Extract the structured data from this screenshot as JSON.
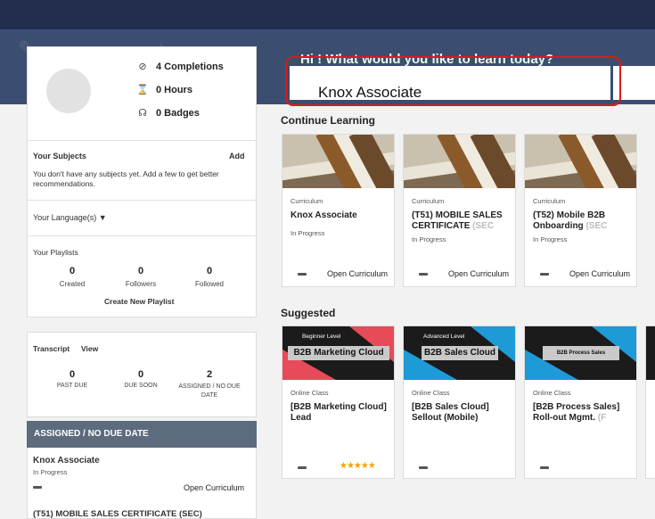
{
  "hero": {
    "title": "Hi ! What would you like to learn today?",
    "search_value": "Knox Associate"
  },
  "profile": {
    "completions": "4 Completions",
    "hours": "0 Hours",
    "badges": "0 Badges",
    "subjects_title": "Your Subjects",
    "subjects_add": "Add",
    "subjects_empty": "You don't have any subjects yet. Add a few to get better recommendations.",
    "language_label": "Your Language(s) ▼",
    "playlists_title": "Your Playlists",
    "playlist_stats": [
      {
        "value": "0",
        "label": "Created"
      },
      {
        "value": "0",
        "label": "Followers"
      },
      {
        "value": "0",
        "label": "Followed"
      }
    ],
    "create_playlist": "Create New Playlist"
  },
  "transcript": {
    "title": "Transcript",
    "view": "View",
    "stats": [
      {
        "value": "0",
        "label": "PAST DUE"
      },
      {
        "value": "0",
        "label": "DUE SOON"
      },
      {
        "value": "2",
        "label": "ASSIGNED / NO DUE DATE"
      }
    ]
  },
  "assigned": {
    "header": "ASSIGNED / NO DUE DATE",
    "item_title": "Knox Associate",
    "item_status": "In Progress",
    "item_action": "Open Curriculum",
    "next_title": "(T51) MOBILE SALES CERTIFICATE (SEC)"
  },
  "continue_learning": {
    "title": "Continue Learning",
    "items": [
      {
        "type": "Curriculum",
        "title": "Knox Associate",
        "title_fade": "",
        "status": "In Progress",
        "action": "Open Curriculum"
      },
      {
        "type": "Curriculum",
        "title": "(T51) MOBILE SALES CERTIFICATE",
        "title_fade": " (SEC",
        "status": "In Progress",
        "action": "Open Curriculum"
      },
      {
        "type": "Curriculum",
        "title": "(T52) Mobile B2B Onboarding",
        "title_fade": " (SEC",
        "status": "In Progress",
        "action": "Open Curriculum"
      }
    ]
  },
  "suggested": {
    "title": "Suggested",
    "items": [
      {
        "level": "Beginner Level",
        "badge": "B2B Marketing Cloud",
        "type": "Online Class",
        "title": "[B2B Marketing Cloud] Lead",
        "title_fade": "",
        "stars": "★★★★★"
      },
      {
        "level": "Advanced Level",
        "badge": "B2B Sales Cloud",
        "type": "Online Class",
        "title": "[B2B Sales Cloud] Sellout (Mobile)",
        "title_fade": ""
      },
      {
        "level": "",
        "badge": "B2B Process Sales",
        "type": "Online Class",
        "title": "[B2B Process Sales] Roll-out Mgmt.",
        "title_fade": " (F"
      }
    ]
  },
  "colors": {
    "topbar": "#222c4d",
    "banner": "#3b4e70",
    "assigned_header": "#5d6b7e",
    "highlight": "#e01818",
    "stars": "#f1a400"
  }
}
